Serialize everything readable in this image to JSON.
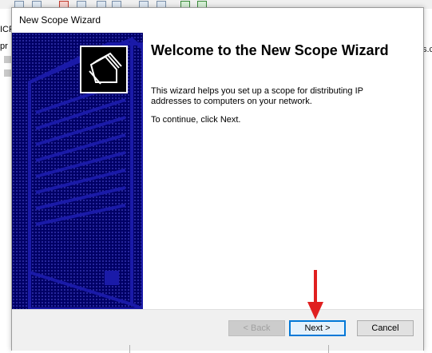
{
  "background": {
    "left_fragments": [
      "ICP",
      "pr"
    ],
    "right_fragment": "s.c"
  },
  "dialog": {
    "title": "New Scope Wizard",
    "heading": "Welcome to the New Scope Wizard",
    "paragraph1": "This wizard helps you set up a scope for distributing IP addresses to computers on your network.",
    "paragraph2": "To continue, click Next.",
    "buttons": {
      "back": "< Back",
      "next": "Next >",
      "cancel": "Cancel"
    }
  },
  "annotation": {
    "arrow_color": "#e02020",
    "points_to": "next-button"
  },
  "colors": {
    "banner": "#000066",
    "banner_art": "#1a1aa8",
    "footer": "#f0f0f0"
  }
}
